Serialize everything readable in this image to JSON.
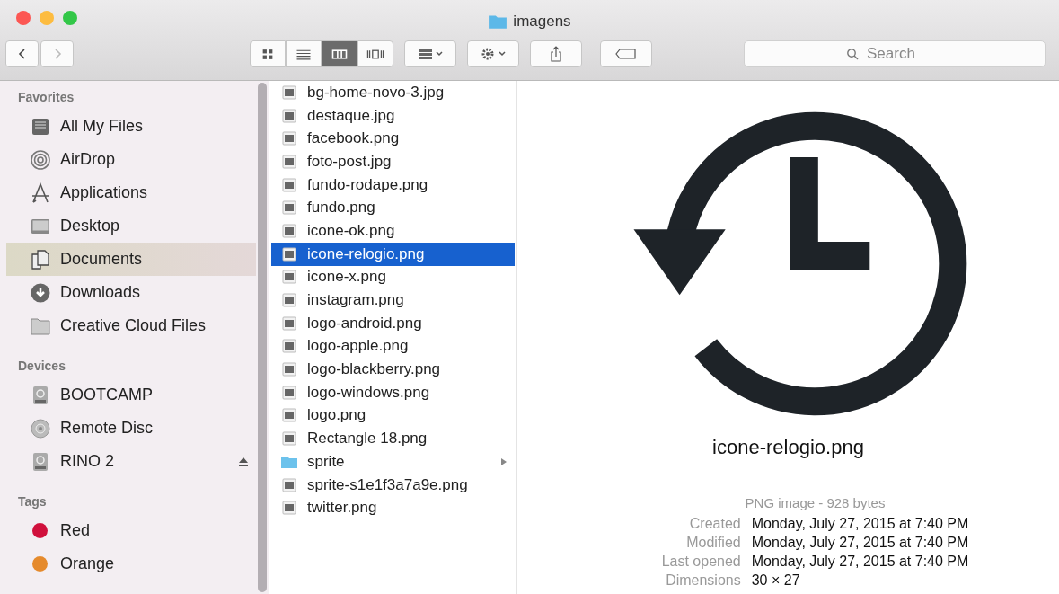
{
  "window": {
    "title": "imagens"
  },
  "toolbar": {
    "views": [
      {
        "kind": "icons",
        "selected": false
      },
      {
        "kind": "list",
        "selected": false
      },
      {
        "kind": "columns",
        "selected": true
      },
      {
        "kind": "coverflow",
        "selected": false
      }
    ],
    "search": {
      "placeholder": "Search"
    }
  },
  "sidebar": {
    "sections": [
      {
        "title": "Favorites",
        "items": [
          {
            "label": "All My Files",
            "kind": "files",
            "selected": false
          },
          {
            "label": "AirDrop",
            "kind": "airdrop",
            "selected": false
          },
          {
            "label": "Applications",
            "kind": "apps",
            "selected": false
          },
          {
            "label": "Desktop",
            "kind": "desktop",
            "selected": false
          },
          {
            "label": "Documents",
            "kind": "documents",
            "selected": true
          },
          {
            "label": "Downloads",
            "kind": "downloads",
            "selected": false
          },
          {
            "label": "Creative Cloud Files",
            "kind": "folder",
            "selected": false
          }
        ]
      },
      {
        "title": "Devices",
        "items": [
          {
            "label": "BOOTCAMP",
            "kind": "disk",
            "selected": false
          },
          {
            "label": "Remote Disc",
            "kind": "disc",
            "selected": false
          },
          {
            "label": "RINO 2",
            "kind": "disk",
            "selected": false,
            "ejectable": true
          }
        ]
      },
      {
        "title": "Tags",
        "items": [
          {
            "label": "Red",
            "kind": "tag",
            "color": "#d0103c",
            "selected": false
          },
          {
            "label": "Orange",
            "kind": "tag",
            "color": "#e58a2c",
            "selected": false
          }
        ]
      }
    ]
  },
  "files": [
    {
      "name": "bg-home-novo-3.jpg",
      "kind": "file",
      "selected": false
    },
    {
      "name": "destaque.jpg",
      "kind": "file",
      "selected": false
    },
    {
      "name": "facebook.png",
      "kind": "file",
      "selected": false
    },
    {
      "name": "foto-post.jpg",
      "kind": "file",
      "selected": false
    },
    {
      "name": "fundo-rodape.png",
      "kind": "file",
      "selected": false
    },
    {
      "name": "fundo.png",
      "kind": "file",
      "selected": false
    },
    {
      "name": "icone-ok.png",
      "kind": "file",
      "selected": false
    },
    {
      "name": "icone-relogio.png",
      "kind": "file",
      "selected": true
    },
    {
      "name": "icone-x.png",
      "kind": "file",
      "selected": false
    },
    {
      "name": "instagram.png",
      "kind": "file",
      "selected": false
    },
    {
      "name": "logo-android.png",
      "kind": "file",
      "selected": false
    },
    {
      "name": "logo-apple.png",
      "kind": "file",
      "selected": false
    },
    {
      "name": "logo-blackberry.png",
      "kind": "file",
      "selected": false
    },
    {
      "name": "logo-windows.png",
      "kind": "file",
      "selected": false
    },
    {
      "name": "logo.png",
      "kind": "file",
      "selected": false
    },
    {
      "name": "Rectangle 18.png",
      "kind": "file",
      "selected": false
    },
    {
      "name": "sprite",
      "kind": "folder",
      "selected": false
    },
    {
      "name": "sprite-s1e1f3a7a9e.png",
      "kind": "file",
      "selected": false
    },
    {
      "name": "twitter.png",
      "kind": "file",
      "selected": false
    }
  ],
  "preview": {
    "name": "icone-relogio.png",
    "summary": "PNG image - 928 bytes",
    "info": [
      {
        "label": "Created",
        "value": "Monday, July 27, 2015 at 7:40 PM"
      },
      {
        "label": "Modified",
        "value": "Monday, July 27, 2015 at 7:40 PM"
      },
      {
        "label": "Last opened",
        "value": "Monday, July 27, 2015 at 7:40 PM"
      },
      {
        "label": "Dimensions",
        "value": "30 × 27"
      }
    ]
  }
}
